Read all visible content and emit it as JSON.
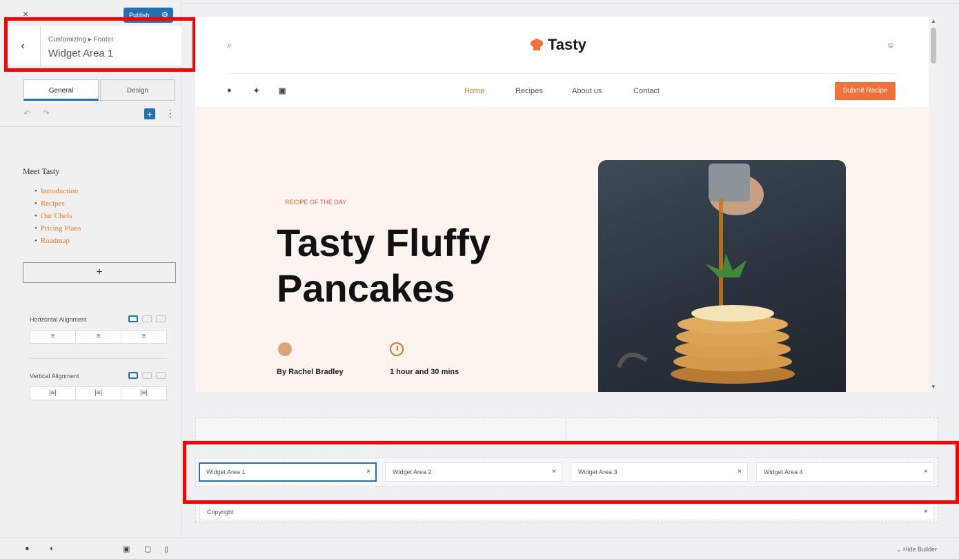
{
  "sidebar": {
    "close_label": "×",
    "publish_label": "Publish",
    "back_label": "‹",
    "breadcrumb": "Customizing ▸ Footer",
    "panel_title": "Widget Area 1",
    "tabs": [
      {
        "label": "General"
      },
      {
        "label": "Design"
      }
    ],
    "widget": {
      "heading": "Meet Tasty",
      "links": [
        "Introduction",
        "Recipes",
        "Our Chefs",
        "Pricing Plans",
        "Roadmap"
      ]
    },
    "add_widget_label": "+",
    "horizontal_alignment_label": "Horizontal Alignment",
    "vertical_alignment_label": "Vertical Alignment",
    "horizontal_options": [
      "≡",
      "≡",
      "≡"
    ],
    "vertical_options": [
      "|≡|",
      "|≡|",
      "|≡|"
    ]
  },
  "preview": {
    "logo": "Tasty",
    "nav": [
      "Home",
      "Recipes",
      "About us",
      "Contact"
    ],
    "submit_label": "Submit Recipe",
    "hero": {
      "tag": "RECIPE OF THE DAY",
      "title": "Tasty Fluffy Pancakes",
      "author": "By Rachel Bradley",
      "duration": "1 hour and 30 mins"
    }
  },
  "builder": {
    "areas": [
      "Widget Area 1",
      "Widget Area 2",
      "Widget Area 3",
      "Widget Area 4"
    ],
    "remove_label": "×",
    "copyright": "Copyright",
    "hide_builder_label": "Hide Builder"
  },
  "colors": {
    "accent": "#2271b1",
    "brand_orange": "#f0713a",
    "highlight_red": "#ff0000"
  }
}
